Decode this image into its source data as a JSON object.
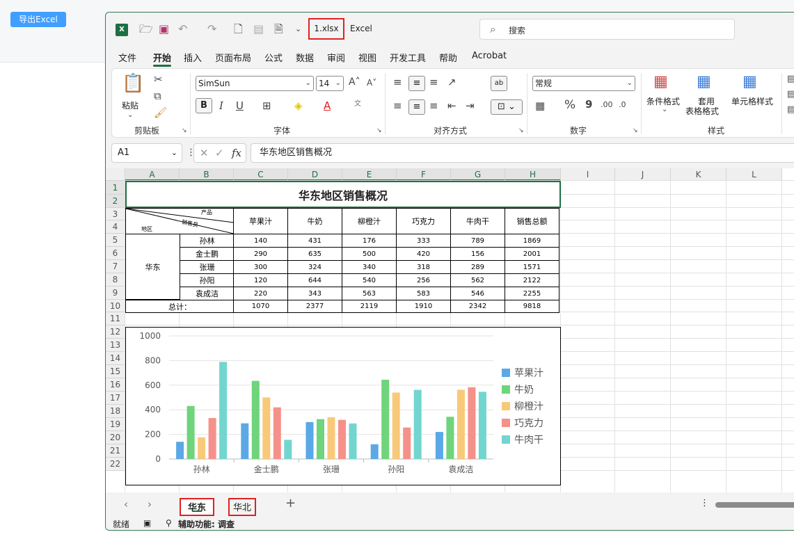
{
  "page": {
    "export_button": "导出Excel"
  },
  "window": {
    "filename": "1.xlsx",
    "app_name": "Excel",
    "search_placeholder": "搜索",
    "menu": [
      "文件",
      "开始",
      "插入",
      "页面布局",
      "公式",
      "数据",
      "审阅",
      "视图",
      "开发工具",
      "帮助",
      "Acrobat"
    ],
    "active_menu": "开始"
  },
  "ribbon": {
    "clipboard": {
      "paste": "粘贴",
      "label": "剪贴板"
    },
    "font": {
      "name": "SimSun",
      "size": "14",
      "label": "字体",
      "bold": "B",
      "italic": "I",
      "underline": "U"
    },
    "alignment": {
      "label": "对齐方式"
    },
    "number": {
      "format": "常规",
      "label": "数字",
      "percent": "%",
      "comma": "9"
    },
    "styles": {
      "conditional": "条件格式",
      "table_format_1": "套用",
      "table_format_2": "表格格式",
      "cell_style": "单元格样式",
      "label": "样式"
    }
  },
  "formula_bar": {
    "cell_ref": "A1",
    "content": "华东地区销售概况"
  },
  "columns": [
    "A",
    "B",
    "C",
    "D",
    "E",
    "F",
    "G",
    "H",
    "I",
    "J",
    "K",
    "L"
  ],
  "rows": [
    "1",
    "2",
    "3",
    "4",
    "5",
    "6",
    "7",
    "8",
    "9",
    "10",
    "11",
    "12",
    "13",
    "14",
    "15",
    "16",
    "17",
    "18",
    "19",
    "20",
    "21",
    "22"
  ],
  "table": {
    "title": "华东地区销售概况",
    "corner_product": "产品",
    "corner_salesperson": "销售员",
    "corner_region": "地区",
    "region": "华东",
    "headers": [
      "苹果汁",
      "牛奶",
      "柳橙汁",
      "巧克力",
      "牛肉干",
      "销售总额"
    ],
    "data_rows": [
      {
        "name": "孙林",
        "values": [
          "140",
          "431",
          "176",
          "333",
          "789",
          "1869"
        ]
      },
      {
        "name": "金士鹏",
        "values": [
          "290",
          "635",
          "500",
          "420",
          "156",
          "2001"
        ]
      },
      {
        "name": "张珊",
        "values": [
          "300",
          "324",
          "340",
          "318",
          "289",
          "1571"
        ]
      },
      {
        "name": "孙阳",
        "values": [
          "120",
          "644",
          "540",
          "256",
          "562",
          "2122"
        ]
      },
      {
        "name": "袁成洁",
        "values": [
          "220",
          "343",
          "563",
          "583",
          "546",
          "2255"
        ]
      }
    ],
    "total_label": "总计：",
    "totals": [
      "1070",
      "2377",
      "2119",
      "1910",
      "2342",
      "9818"
    ]
  },
  "chart_data": {
    "type": "bar",
    "categories": [
      "孙林",
      "金士鹏",
      "张珊",
      "孙阳",
      "袁成洁"
    ],
    "series": [
      {
        "name": "苹果汁",
        "values": [
          140,
          290,
          300,
          120,
          220
        ],
        "color": "#5aa9e6"
      },
      {
        "name": "牛奶",
        "values": [
          431,
          635,
          324,
          644,
          343
        ],
        "color": "#6fd47b"
      },
      {
        "name": "柳橙汁",
        "values": [
          176,
          500,
          340,
          540,
          563
        ],
        "color": "#f9c97a"
      },
      {
        "name": "巧克力",
        "values": [
          333,
          420,
          318,
          256,
          583
        ],
        "color": "#f5918a"
      },
      {
        "name": "牛肉干",
        "values": [
          789,
          156,
          289,
          562,
          546
        ],
        "color": "#72d6cf"
      }
    ],
    "yticks": [
      0,
      200,
      400,
      600,
      800,
      1000
    ],
    "ylim": [
      0,
      1000
    ],
    "grid": true,
    "legend": "right"
  },
  "sheets": [
    {
      "name": "华东",
      "active": true
    },
    {
      "name": "华北",
      "active": false
    }
  ],
  "status": {
    "ready": "就绪",
    "accessibility": "辅助功能: 调查"
  },
  "colors": {
    "excel_green": "#1d6f42",
    "highlight_red": "#e02020",
    "button_blue": "#409eff"
  }
}
